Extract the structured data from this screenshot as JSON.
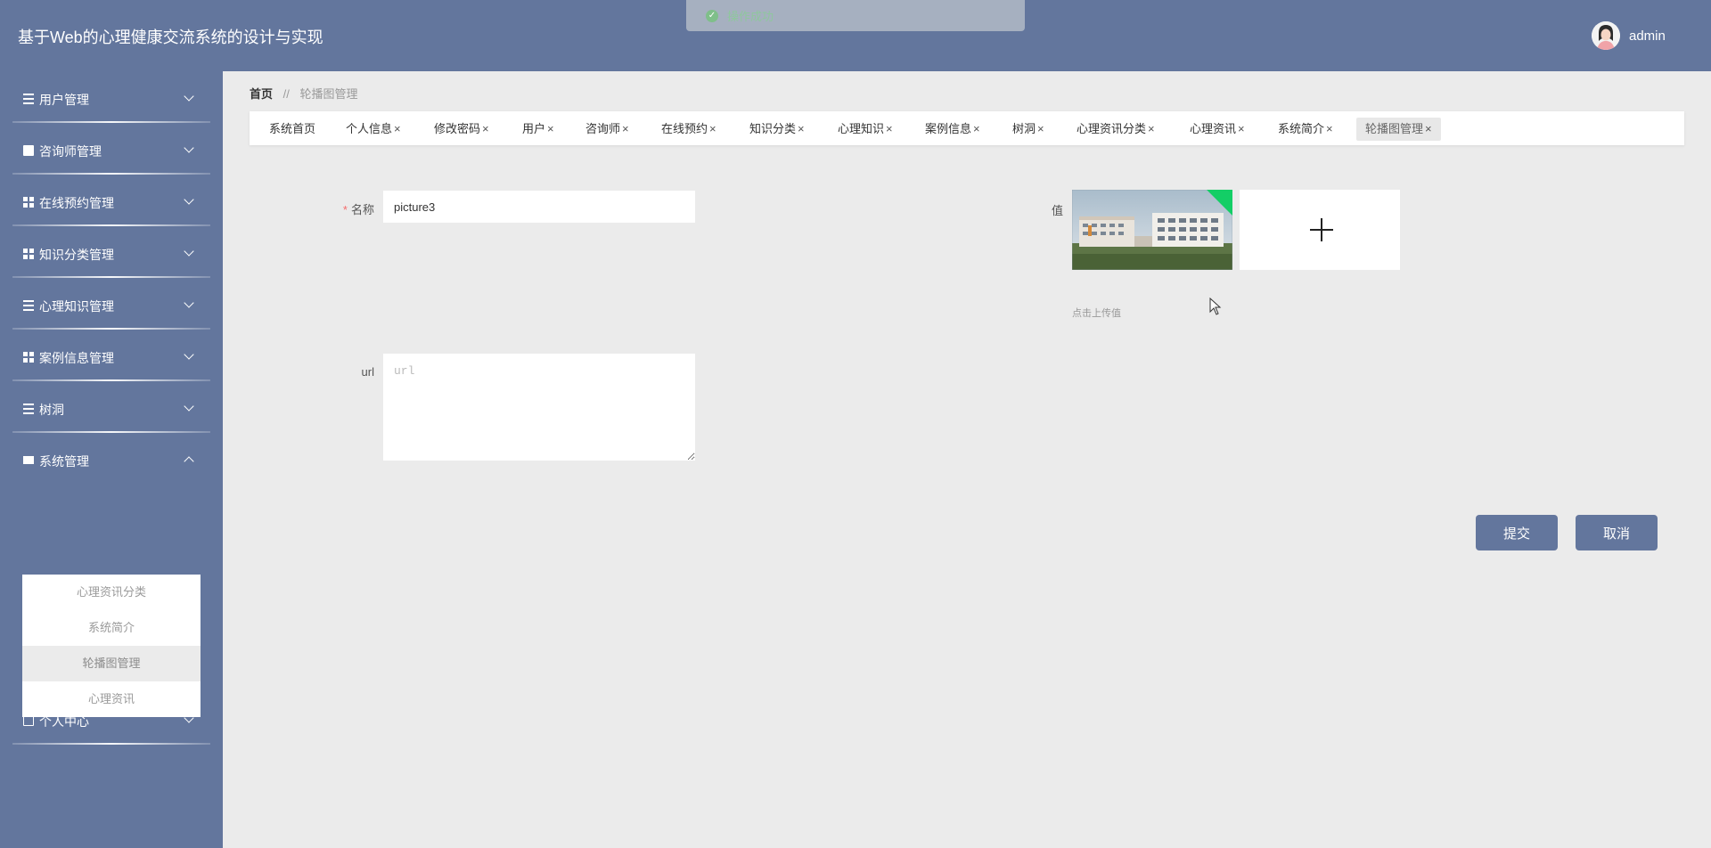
{
  "header": {
    "title": "基于Web的心理健康交流系统的设计与实现",
    "username": "admin"
  },
  "toast": {
    "text": "操作成功"
  },
  "sidebar": {
    "items": [
      {
        "label": "用户管理",
        "icon": "list-icon"
      },
      {
        "label": "咨询师管理",
        "icon": "clipboard-icon"
      },
      {
        "label": "在线预约管理",
        "icon": "grid-icon"
      },
      {
        "label": "知识分类管理",
        "icon": "grid-icon"
      },
      {
        "label": "心理知识管理",
        "icon": "list-icon"
      },
      {
        "label": "案例信息管理",
        "icon": "grid-icon"
      },
      {
        "label": "树洞",
        "icon": "sliders-icon"
      },
      {
        "label": "系统管理",
        "icon": "monitor-icon"
      },
      {
        "label": "个人中心",
        "icon": "wallet-icon"
      }
    ],
    "submenu": [
      {
        "label": "心理资讯分类"
      },
      {
        "label": "系统简介"
      },
      {
        "label": "轮播图管理"
      },
      {
        "label": "心理资讯"
      }
    ]
  },
  "breadcrumb": {
    "home": "首页",
    "separator": "//",
    "current": "轮播图管理"
  },
  "tabs": [
    {
      "label": "系统首页",
      "close": ""
    },
    {
      "label": "个人信息",
      "close": "×"
    },
    {
      "label": "修改密码",
      "close": "×"
    },
    {
      "label": "用户",
      "close": "×"
    },
    {
      "label": "咨询师",
      "close": "×"
    },
    {
      "label": "在线预约",
      "close": "×"
    },
    {
      "label": "知识分类",
      "close": "×"
    },
    {
      "label": "心理知识",
      "close": "×"
    },
    {
      "label": "案例信息",
      "close": "×"
    },
    {
      "label": "树洞",
      "close": "×"
    },
    {
      "label": "心理资讯分类",
      "close": "×"
    },
    {
      "label": "心理资讯",
      "close": "×"
    },
    {
      "label": "系统简介",
      "close": "×"
    },
    {
      "label": "轮播图管理",
      "close": "×"
    }
  ],
  "form": {
    "required_mark": "*",
    "name_label": "名称",
    "name_value": "picture3",
    "url_label": "url",
    "url_placeholder": "url",
    "value_label": "值",
    "upload_tip": "点击上传值",
    "submit_label": "提交",
    "cancel_label": "取消"
  },
  "colors": {
    "primary": "#63769d",
    "background": "#ebebeb",
    "success": "#13ce66"
  }
}
